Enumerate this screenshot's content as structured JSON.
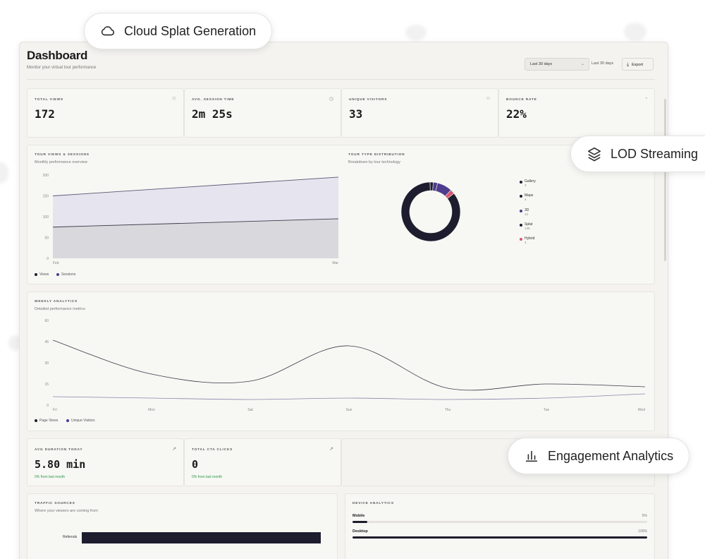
{
  "header": {
    "title": "Dashboard",
    "subtitle": "Monitor your virtual tour performance",
    "range_select": "Last 30 days",
    "range_text": "Last 30 days",
    "export_label": "Export"
  },
  "stats": [
    {
      "label": "TOTAL VIEWS",
      "value": "172",
      "icon": "eye-icon"
    },
    {
      "label": "AVG. SESSION TIME",
      "value": "2m 25s",
      "icon": "clock-icon"
    },
    {
      "label": "UNIQUE VISITORS",
      "value": "33",
      "icon": "user-icon"
    },
    {
      "label": "BOUNCE RATE",
      "value": "22%",
      "icon": "bar-chart-icon"
    }
  ],
  "tour_views": {
    "title": "TOUR VIEWS & SESSIONS",
    "subtitle": "Monthly performance overview",
    "legend": [
      "Views",
      "Sessions"
    ]
  },
  "tour_type": {
    "title": "TOUR TYPE DISTRIBUTION",
    "subtitle": "Breakdown by tour technology",
    "legend": [
      {
        "name": "Gallery",
        "count": "3"
      },
      {
        "name": "Maps",
        "count": "4"
      },
      {
        "name": "3D",
        "count": "14"
      },
      {
        "name": "Splat",
        "count": "145"
      },
      {
        "name": "Hybrid",
        "count": "4"
      }
    ]
  },
  "weekly": {
    "title": "WEEKLY ANALYTICS",
    "subtitle": "Detailed performance metrics",
    "legend": [
      "Page Views",
      "Unique Visitors"
    ]
  },
  "metrics": [
    {
      "label": "AVG DURATION TODAY",
      "value": "5.80 min",
      "change": "0% from last month"
    },
    {
      "label": "TOTAL CTA CLICKS",
      "value": "0",
      "change": "0% from last month"
    }
  ],
  "traffic": {
    "title": "TRAFFIC SOURCES",
    "subtitle": "Where your viewers are coming from",
    "rows": [
      {
        "name": "Referrals",
        "fraction": 1.0
      }
    ]
  },
  "devices": {
    "title": "DEVICE ANALYTICS",
    "rows": [
      {
        "name": "Mobile",
        "pct": "5%",
        "fraction": 0.05
      },
      {
        "name": "Desktop",
        "pct": "100%",
        "fraction": 1.0
      }
    ]
  },
  "chips": {
    "cloud": "Cloud Splat Generation",
    "lod": "LOD Streaming",
    "engagement": "Engagement Analytics"
  },
  "colors": {
    "navy": "#1d1d2f",
    "purple": "#4e3c8e",
    "red": "#d9576d",
    "area_top": "#e6e4ee",
    "area_bottom": "#d9d8dc"
  },
  "chart_data": [
    {
      "type": "area",
      "x": [
        "Feb",
        "Mar"
      ],
      "series": [
        {
          "name": "Views",
          "values": [
            150,
            195
          ]
        },
        {
          "name": "Sessions",
          "values": [
            75,
            95
          ]
        }
      ],
      "y_ticks": [
        "200",
        "150",
        "100",
        "50",
        "0"
      ],
      "ylim": [
        0,
        200
      ],
      "legend": "bottom-left"
    },
    {
      "type": "pie",
      "labels": [
        "Gallery",
        "Maps",
        "3D",
        "Splat",
        "Hybrid"
      ],
      "values": [
        3,
        4,
        14,
        145,
        4
      ]
    },
    {
      "type": "line",
      "x": [
        "Fri",
        "Mon",
        "Sat",
        "Sun",
        "Thu",
        "Tue",
        "Wed"
      ],
      "series": [
        {
          "name": "Page Views",
          "values": [
            46,
            22,
            17,
            42,
            12,
            15,
            13
          ]
        },
        {
          "name": "Unique Visitors",
          "values": [
            6,
            5,
            4,
            5,
            4,
            5,
            8
          ]
        }
      ],
      "y_ticks": [
        "60",
        "45",
        "30",
        "15",
        "0"
      ],
      "ylim": [
        0,
        60
      ],
      "legend": "bottom-left"
    }
  ]
}
